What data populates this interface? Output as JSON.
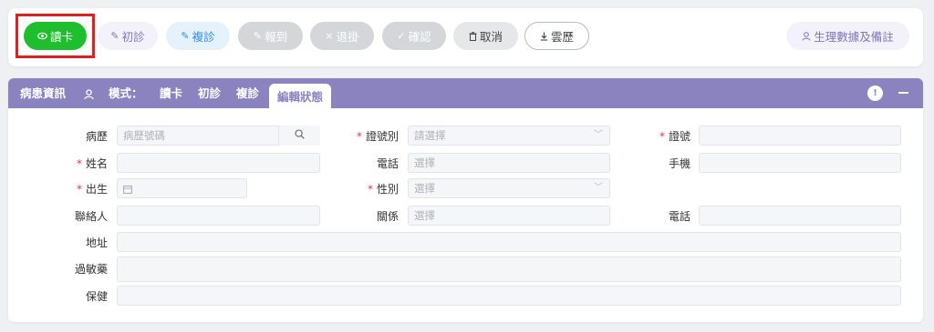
{
  "toolbar": {
    "read_card": "讀卡",
    "first_visit": "初診",
    "revisit": "複診",
    "report": "報到",
    "withdraw": "退掛",
    "confirm": "確認",
    "cancel": "取消",
    "cloud_history": "雲歷",
    "vital_signs": "生理數據及備註"
  },
  "panel": {
    "title": "病患資訊",
    "mode_label": "模式：",
    "modes": [
      "讀卡",
      "初診",
      "複診"
    ],
    "active_tab": "編輯狀態",
    "info_glyph": "!"
  },
  "form": {
    "history_label": "病歷",
    "history_placeholder": "病歷號碼",
    "id_type_label": "證號別",
    "id_type_placeholder": "請選擇",
    "id_no_label": "證號",
    "name_label": "姓名",
    "phone_label": "電話",
    "phone_placeholder": "選擇",
    "mobile_label": "手機",
    "birth_label": "出生",
    "gender_label": "性別",
    "gender_placeholder": "選擇",
    "contact_label": "聯絡人",
    "relation_label": "關係",
    "relation_placeholder": "選擇",
    "contact_phone_label": "電話",
    "address_label": "地址",
    "allergy_label": "過敏藥",
    "insurance_label": "保健",
    "required_mark": "*"
  },
  "colors": {
    "header_bg": "#8a83c0",
    "read_card_bg": "#1ebe2e",
    "required": "#e0383e",
    "highlight": "#e01f1f"
  }
}
